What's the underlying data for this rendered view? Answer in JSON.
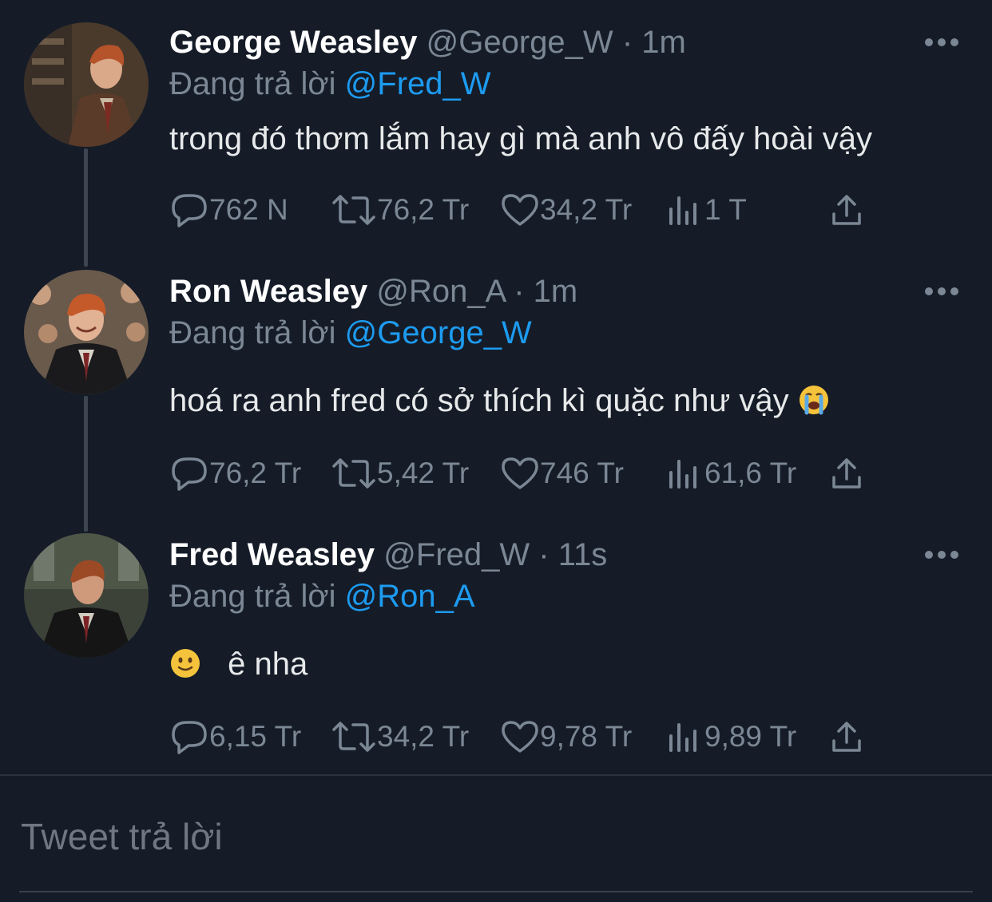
{
  "reply_prefix": "Đang trả lời",
  "tweets": [
    {
      "name": "George Weasley",
      "handle": "@George_W",
      "separator": "·",
      "time": "1m",
      "reply_to": "@Fred_W",
      "text": "trong đó thơm lắm hay gì mà anh vô đấy hoài vậy",
      "emoji": "",
      "avatar_icon": "george-weasley-avatar",
      "stats": {
        "replies": "762 N",
        "retweets": "76,2 Tr",
        "likes": "34,2 Tr",
        "views": "1 T"
      }
    },
    {
      "name": "Ron Weasley",
      "handle": "@Ron_A",
      "separator": "·",
      "time": "1m",
      "reply_to": "@George_W",
      "text": "hoá ra anh fred có sở thích kì quặc như vậy",
      "emoji": "loudly-crying-face-icon",
      "avatar_icon": "ron-weasley-avatar",
      "stats": {
        "replies": "76,2 Tr",
        "retweets": "5,42 Tr",
        "likes": "746 Tr",
        "views": "61,6 Tr"
      }
    },
    {
      "name": "Fred Weasley",
      "handle": "@Fred_W",
      "separator": "·",
      "time": "11s",
      "reply_to": "@Ron_A",
      "text": "ê nha",
      "emoji": "slightly-smiling-face-icon",
      "avatar_icon": "fred-weasley-avatar",
      "stats": {
        "replies": "6,15 Tr",
        "retweets": "34,2 Tr",
        "likes": "9,78 Tr",
        "views": "9,89 Tr"
      }
    }
  ],
  "compose": {
    "placeholder": "Tweet trả lời"
  },
  "colors": {
    "background": "#151c28",
    "text": "#e7e9ea",
    "muted": "#7b8794",
    "link": "#1d9bf0",
    "thread_line": "#3d4550"
  }
}
